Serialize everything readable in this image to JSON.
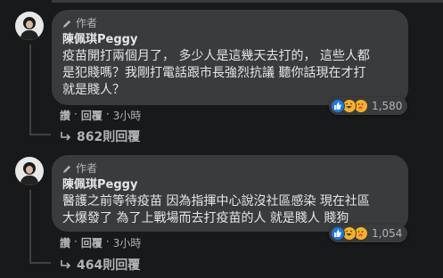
{
  "comments": [
    {
      "author_tag": "作者",
      "name": "陳佩琪Peggy",
      "text_lines": [
        "疫苗開打兩個月了， 多少人是這幾天去打的， 這些人都",
        "是犯賤嗎？我剛打電話跟市長強烈抗議 聽你話現在才打",
        "就是賤人？"
      ],
      "reaction_count": "1,580",
      "actions": [
        "讚",
        "·",
        "回覆",
        "·",
        "3小時"
      ],
      "replies": "862則回覆"
    },
    {
      "author_tag": "作者",
      "name": "陳佩琪Peggy",
      "text_lines": [
        "醫護之前等待疫苗 因為指揮中心說沒社區感染 現在社區",
        "大爆發了 為了上戰場而去打疫苗的人 就是賤人 賤狗"
      ],
      "reaction_count": "1,054",
      "actions": [
        "讚",
        "·",
        "回覆",
        "·",
        "3小時"
      ],
      "replies": "464則回覆"
    }
  ],
  "icons": {
    "author": "pen-icon",
    "reactions": [
      "like-icon",
      "haha-icon",
      "care-icon"
    ],
    "replies": "reply-arrow-icon"
  },
  "colors": {
    "background": "#18191a",
    "bubble": "#3a3b3c",
    "like": "#1877f2",
    "emoji": "#f7b125"
  }
}
